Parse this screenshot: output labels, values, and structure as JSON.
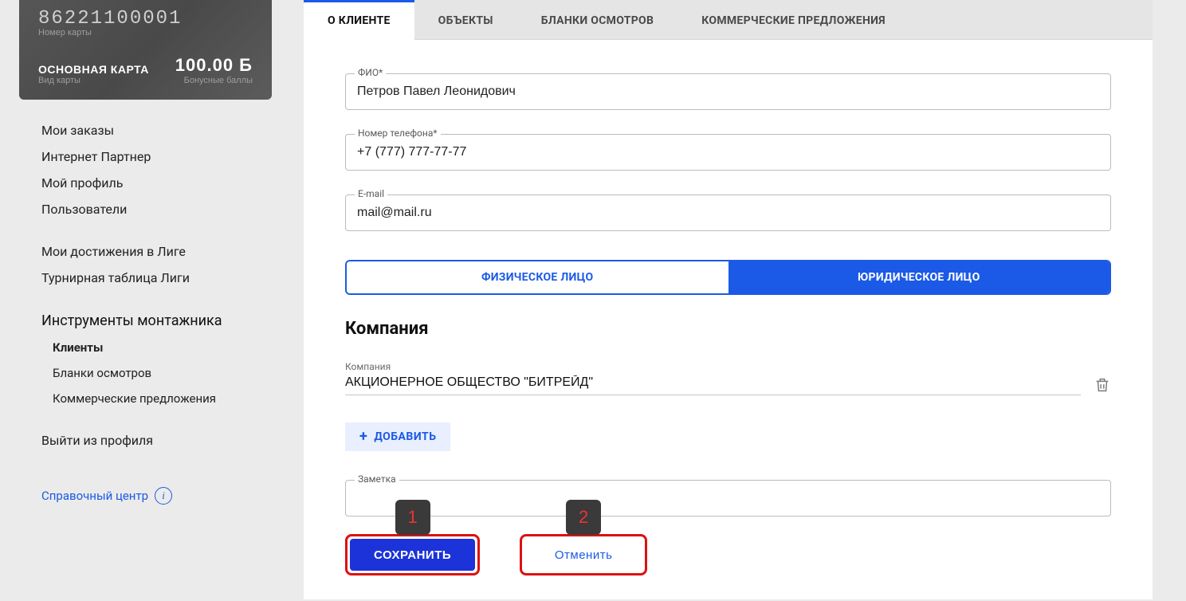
{
  "card": {
    "number": "86221100001",
    "number_label": "Номер карты",
    "type_title": "ОСНОВНАЯ КАРТА",
    "type_sub": "Вид карты",
    "balance": "100.00 Б",
    "balance_sub": "Бонусные баллы"
  },
  "sidebar": {
    "items1": [
      "Мои заказы",
      "Интернет Партнер",
      "Мой профиль",
      "Пользователи"
    ],
    "items2": [
      "Мои достижения в Лиге",
      "Турнирная таблица Лиги"
    ],
    "tools_title": "Инструменты монтажника",
    "tools_items": [
      "Клиенты",
      "Бланки осмотров",
      "Коммерческие предложения"
    ],
    "logout": "Выйти из профиля",
    "help": "Справочный центр"
  },
  "tabs": [
    "О КЛИЕНТЕ",
    "ОБЪЕКТЫ",
    "БЛАНКИ ОСМОТРОВ",
    "КОММЕРЧЕСКИЕ ПРЕДЛОЖЕНИЯ"
  ],
  "fields": {
    "fio_label": "ФИО*",
    "fio_value": "Петров Павел Леонидович",
    "phone_label": "Номер телефона*",
    "phone_value": "+7 (777) 777-77-77",
    "email_label": "E-mail",
    "email_value": "mail@mail.ru"
  },
  "toggle": {
    "left": "ФИЗИЧЕСКОЕ ЛИЦО",
    "right": "ЮРИДИЧЕСКОЕ ЛИЦО"
  },
  "company": {
    "section": "Компания",
    "label": "Компания",
    "value": "АКЦИОНЕРНОЕ ОБЩЕСТВО \"БИТРЕЙД\"",
    "add": "ДОБАВИТЬ"
  },
  "note_label": "Заметка",
  "actions": {
    "save": "СОХРАНИТЬ",
    "cancel": "Отменить"
  },
  "annotations": {
    "save": "1",
    "cancel": "2"
  }
}
